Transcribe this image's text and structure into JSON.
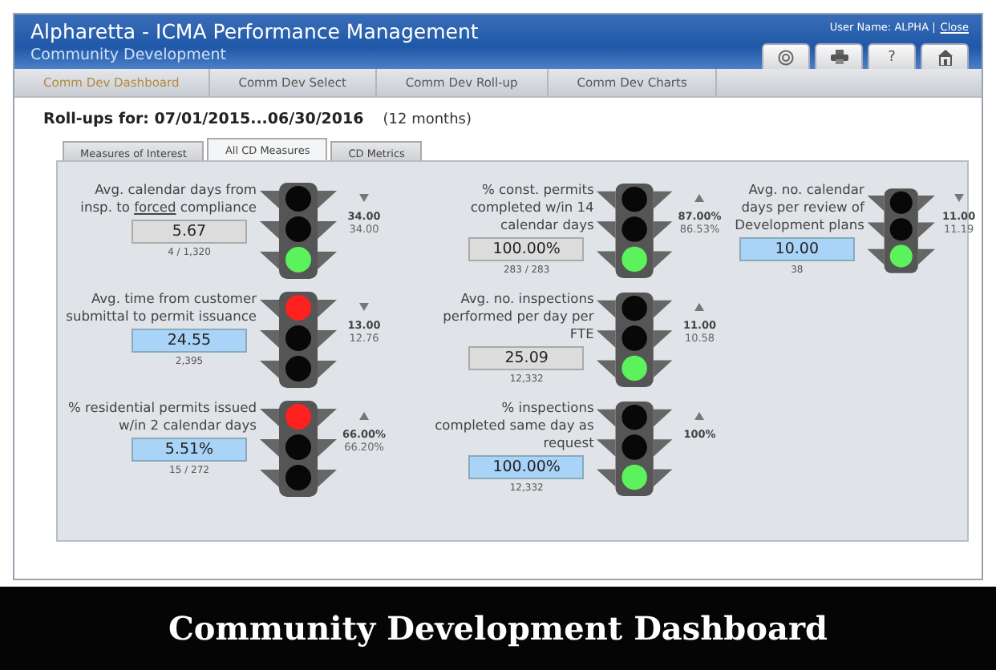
{
  "header": {
    "title": "Alpharetta - ICMA Performance Management",
    "subtitle": "Community Development",
    "user": "User Name: ALPHA |",
    "close": "Close",
    "tools": [
      {
        "kind": "target"
      },
      {
        "kind": "print"
      },
      {
        "kind": "text",
        "text": "?"
      },
      {
        "kind": "home"
      }
    ]
  },
  "nav_tabs": [
    {
      "label": "Comm Dev Dashboard",
      "selected": true
    },
    {
      "label": "Comm Dev Select",
      "selected": false
    },
    {
      "label": "Comm Dev Roll-up",
      "selected": false
    },
    {
      "label": "Comm Dev Charts",
      "selected": false
    }
  ],
  "rollup": {
    "label": "Roll-ups for: 07/01/2015...06/30/2016",
    "period": "(12 months)"
  },
  "sub_tabs": [
    {
      "label": "Measures of Interest",
      "selected": false
    },
    {
      "label": "All CD Measures",
      "selected": true
    },
    {
      "label": "CD Metrics",
      "selected": false
    }
  ],
  "measures": [
    {
      "label": [
        {
          "text": "Avg. calendar days from insp. to "
        },
        {
          "text": "forced",
          "underline": true
        },
        {
          "text": " compliance"
        }
      ],
      "value": "5.67",
      "highlight": false,
      "count": "4 / 1,320",
      "red": false,
      "trend_up": false,
      "target": "34.00",
      "actual": "34.00"
    },
    {
      "label": [
        {
          "text": "% const. permits completed w/in 14 calendar days"
        }
      ],
      "value": "100.00%",
      "highlight": false,
      "count": "283 / 283",
      "red": false,
      "trend_up": true,
      "target": "87.00%",
      "actual": "86.53%"
    },
    {
      "label": [
        {
          "text": "Avg. no. calendar days per review of Development plans"
        }
      ],
      "value": "10.00",
      "highlight": true,
      "count": "38",
      "red": false,
      "trend_up": false,
      "target": "11.00",
      "actual": "11.19"
    },
    {
      "label": [
        {
          "text": "Avg. time from customer submittal to permit issuance"
        }
      ],
      "value": "24.55",
      "highlight": true,
      "count": "2,395",
      "red": true,
      "trend_up": false,
      "target": "13.00",
      "actual": "12.76"
    },
    {
      "label": [
        {
          "text": "Avg. no. inspections performed per day per FTE"
        }
      ],
      "value": "25.09",
      "highlight": false,
      "count": "12,332",
      "red": false,
      "trend_up": true,
      "target": "11.00",
      "actual": "10.58"
    },
    {
      "label": [
        {
          "text": "% residential permits issued w/in 2 calendar days"
        }
      ],
      "value": "5.51%",
      "highlight": true,
      "count": "15 / 272",
      "red": true,
      "trend_up": true,
      "target": "66.00%",
      "actual": "66.20%"
    },
    {
      "label": [
        {
          "text": "% inspections completed same day as request"
        }
      ],
      "value": "100.00%",
      "highlight": true,
      "count": "12,332",
      "red": false,
      "trend_up": true,
      "target": "100%"
    }
  ],
  "caption": "Community Development Dashboard"
}
